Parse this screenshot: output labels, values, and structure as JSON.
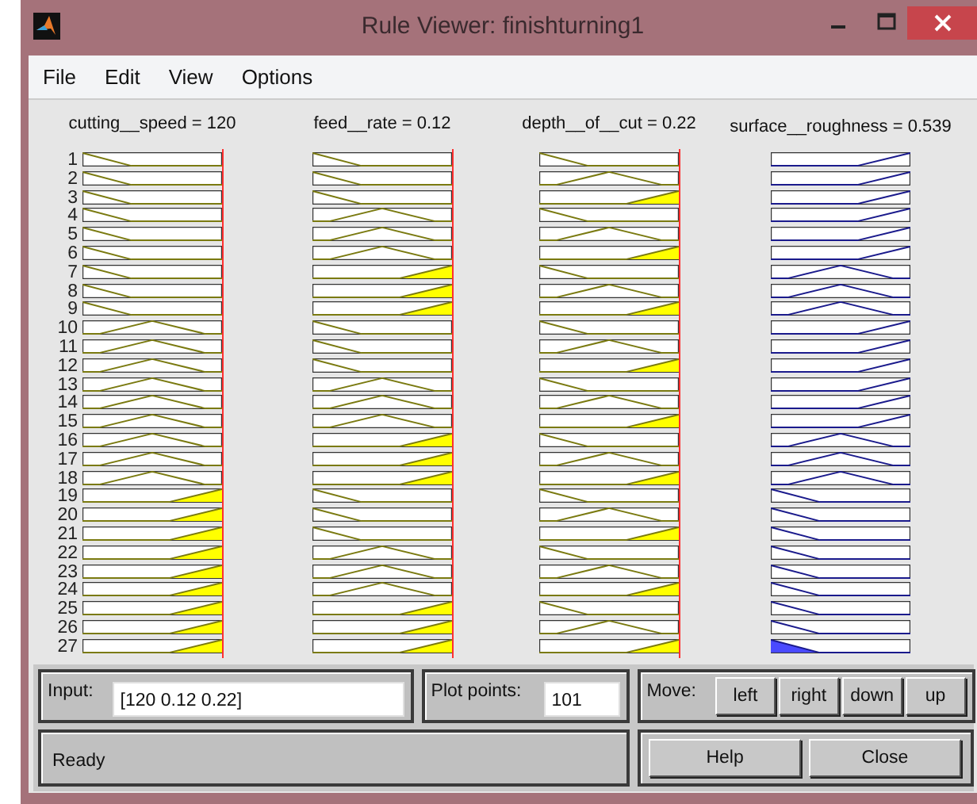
{
  "window": {
    "title": "Rule Viewer: finishturning1"
  },
  "menu": [
    "File",
    "Edit",
    "View",
    "Options"
  ],
  "rule_numbers": [
    "1",
    "2",
    "3",
    "4",
    "5",
    "6",
    "7",
    "8",
    "9",
    "10",
    "11",
    "12",
    "13",
    "14",
    "15",
    "16",
    "17",
    "18",
    "19",
    "20",
    "21",
    "22",
    "23",
    "24",
    "25",
    "26",
    "27"
  ],
  "variables": [
    {
      "header": "cutting__speed = 120",
      "kind": "input",
      "rules": [
        {
          "kind": "low",
          "fired": false
        },
        {
          "kind": "low",
          "fired": false
        },
        {
          "kind": "low",
          "fired": false
        },
        {
          "kind": "low",
          "fired": false
        },
        {
          "kind": "low",
          "fired": false
        },
        {
          "kind": "low",
          "fired": false
        },
        {
          "kind": "low",
          "fired": false
        },
        {
          "kind": "low",
          "fired": false
        },
        {
          "kind": "low",
          "fired": false
        },
        {
          "kind": "mid",
          "fired": false
        },
        {
          "kind": "mid",
          "fired": false
        },
        {
          "kind": "mid",
          "fired": false
        },
        {
          "kind": "mid",
          "fired": false
        },
        {
          "kind": "mid",
          "fired": false
        },
        {
          "kind": "mid",
          "fired": false
        },
        {
          "kind": "mid",
          "fired": false
        },
        {
          "kind": "mid",
          "fired": false
        },
        {
          "kind": "mid",
          "fired": false
        },
        {
          "kind": "high",
          "fired": true
        },
        {
          "kind": "high",
          "fired": true
        },
        {
          "kind": "high",
          "fired": true
        },
        {
          "kind": "high",
          "fired": true
        },
        {
          "kind": "high",
          "fired": true
        },
        {
          "kind": "high",
          "fired": true
        },
        {
          "kind": "high",
          "fired": true
        },
        {
          "kind": "high",
          "fired": true
        },
        {
          "kind": "high",
          "fired": true
        }
      ]
    },
    {
      "header": "feed__rate = 0.12",
      "kind": "input",
      "rules": [
        {
          "kind": "low",
          "fired": false
        },
        {
          "kind": "low",
          "fired": false
        },
        {
          "kind": "low",
          "fired": false
        },
        {
          "kind": "mid",
          "fired": false
        },
        {
          "kind": "mid",
          "fired": false
        },
        {
          "kind": "mid",
          "fired": false
        },
        {
          "kind": "high",
          "fired": true
        },
        {
          "kind": "high",
          "fired": true
        },
        {
          "kind": "high",
          "fired": true
        },
        {
          "kind": "low",
          "fired": false
        },
        {
          "kind": "low",
          "fired": false
        },
        {
          "kind": "low",
          "fired": false
        },
        {
          "kind": "mid",
          "fired": false
        },
        {
          "kind": "mid",
          "fired": false
        },
        {
          "kind": "mid",
          "fired": false
        },
        {
          "kind": "high",
          "fired": true
        },
        {
          "kind": "high",
          "fired": true
        },
        {
          "kind": "high",
          "fired": true
        },
        {
          "kind": "low",
          "fired": false
        },
        {
          "kind": "low",
          "fired": false
        },
        {
          "kind": "low",
          "fired": false
        },
        {
          "kind": "mid",
          "fired": false
        },
        {
          "kind": "mid",
          "fired": false
        },
        {
          "kind": "mid",
          "fired": false
        },
        {
          "kind": "high",
          "fired": true
        },
        {
          "kind": "high",
          "fired": true
        },
        {
          "kind": "high",
          "fired": true
        }
      ]
    },
    {
      "header": "depth__of__cut = 0.22",
      "kind": "input",
      "rules": [
        {
          "kind": "low",
          "fired": false
        },
        {
          "kind": "mid",
          "fired": false
        },
        {
          "kind": "high",
          "fired": true
        },
        {
          "kind": "low",
          "fired": false
        },
        {
          "kind": "mid",
          "fired": false
        },
        {
          "kind": "high",
          "fired": true
        },
        {
          "kind": "low",
          "fired": false
        },
        {
          "kind": "mid",
          "fired": false
        },
        {
          "kind": "high",
          "fired": true
        },
        {
          "kind": "low",
          "fired": false
        },
        {
          "kind": "mid",
          "fired": false
        },
        {
          "kind": "high",
          "fired": true
        },
        {
          "kind": "low",
          "fired": false
        },
        {
          "kind": "mid",
          "fired": false
        },
        {
          "kind": "high",
          "fired": true
        },
        {
          "kind": "low",
          "fired": false
        },
        {
          "kind": "mid",
          "fired": false
        },
        {
          "kind": "high",
          "fired": true
        },
        {
          "kind": "low",
          "fired": false
        },
        {
          "kind": "mid",
          "fired": false
        },
        {
          "kind": "high",
          "fired": true
        },
        {
          "kind": "low",
          "fired": false
        },
        {
          "kind": "mid",
          "fired": false
        },
        {
          "kind": "high",
          "fired": true
        },
        {
          "kind": "low",
          "fired": false
        },
        {
          "kind": "mid",
          "fired": false
        },
        {
          "kind": "high",
          "fired": true
        }
      ]
    },
    {
      "header": "surface__roughness = 0.539",
      "kind": "output",
      "rules": [
        {
          "kind": "high",
          "fired": false
        },
        {
          "kind": "high",
          "fired": false
        },
        {
          "kind": "high",
          "fired": false
        },
        {
          "kind": "high",
          "fired": false
        },
        {
          "kind": "high",
          "fired": false
        },
        {
          "kind": "high",
          "fired": false
        },
        {
          "kind": "mid",
          "fired": false
        },
        {
          "kind": "mid",
          "fired": false
        },
        {
          "kind": "mid",
          "fired": false
        },
        {
          "kind": "high",
          "fired": false
        },
        {
          "kind": "high",
          "fired": false
        },
        {
          "kind": "high",
          "fired": false
        },
        {
          "kind": "high",
          "fired": false
        },
        {
          "kind": "high",
          "fired": false
        },
        {
          "kind": "high",
          "fired": false
        },
        {
          "kind": "mid",
          "fired": false
        },
        {
          "kind": "mid",
          "fired": false
        },
        {
          "kind": "mid",
          "fired": false
        },
        {
          "kind": "low",
          "fired": false
        },
        {
          "kind": "low",
          "fired": false
        },
        {
          "kind": "low",
          "fired": false
        },
        {
          "kind": "low",
          "fired": false
        },
        {
          "kind": "low",
          "fired": false
        },
        {
          "kind": "low",
          "fired": false
        },
        {
          "kind": "low",
          "fired": false
        },
        {
          "kind": "low",
          "fired": false
        },
        {
          "kind": "low",
          "fired": true
        }
      ]
    }
  ],
  "input": {
    "label": "Input:",
    "value": "[120 0.12 0.22]"
  },
  "plot_points": {
    "label": "Plot points:",
    "value": "101"
  },
  "move": {
    "label": "Move:",
    "buttons": [
      "left",
      "right",
      "down",
      "up"
    ]
  },
  "status": "Ready",
  "buttons": [
    "Help",
    "Close"
  ]
}
